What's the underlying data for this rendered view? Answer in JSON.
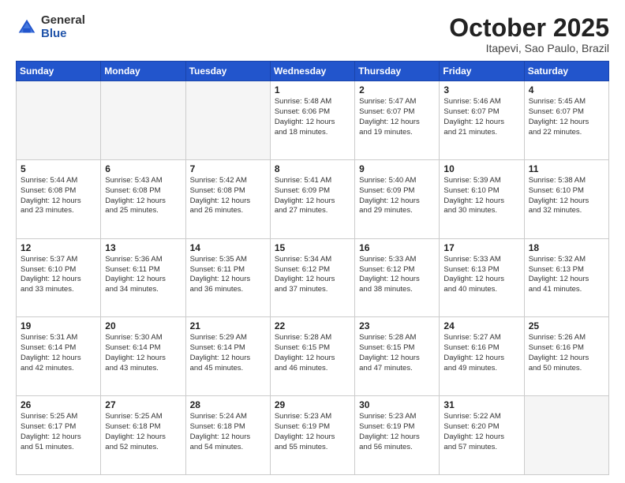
{
  "header": {
    "logo_general": "General",
    "logo_blue": "Blue",
    "month": "October 2025",
    "location": "Itapevi, Sao Paulo, Brazil"
  },
  "days_of_week": [
    "Sunday",
    "Monday",
    "Tuesday",
    "Wednesday",
    "Thursday",
    "Friday",
    "Saturday"
  ],
  "weeks": [
    [
      {
        "day": "",
        "info": ""
      },
      {
        "day": "",
        "info": ""
      },
      {
        "day": "",
        "info": ""
      },
      {
        "day": "1",
        "info": "Sunrise: 5:48 AM\nSunset: 6:06 PM\nDaylight: 12 hours\nand 18 minutes."
      },
      {
        "day": "2",
        "info": "Sunrise: 5:47 AM\nSunset: 6:07 PM\nDaylight: 12 hours\nand 19 minutes."
      },
      {
        "day": "3",
        "info": "Sunrise: 5:46 AM\nSunset: 6:07 PM\nDaylight: 12 hours\nand 21 minutes."
      },
      {
        "day": "4",
        "info": "Sunrise: 5:45 AM\nSunset: 6:07 PM\nDaylight: 12 hours\nand 22 minutes."
      }
    ],
    [
      {
        "day": "5",
        "info": "Sunrise: 5:44 AM\nSunset: 6:08 PM\nDaylight: 12 hours\nand 23 minutes."
      },
      {
        "day": "6",
        "info": "Sunrise: 5:43 AM\nSunset: 6:08 PM\nDaylight: 12 hours\nand 25 minutes."
      },
      {
        "day": "7",
        "info": "Sunrise: 5:42 AM\nSunset: 6:08 PM\nDaylight: 12 hours\nand 26 minutes."
      },
      {
        "day": "8",
        "info": "Sunrise: 5:41 AM\nSunset: 6:09 PM\nDaylight: 12 hours\nand 27 minutes."
      },
      {
        "day": "9",
        "info": "Sunrise: 5:40 AM\nSunset: 6:09 PM\nDaylight: 12 hours\nand 29 minutes."
      },
      {
        "day": "10",
        "info": "Sunrise: 5:39 AM\nSunset: 6:10 PM\nDaylight: 12 hours\nand 30 minutes."
      },
      {
        "day": "11",
        "info": "Sunrise: 5:38 AM\nSunset: 6:10 PM\nDaylight: 12 hours\nand 32 minutes."
      }
    ],
    [
      {
        "day": "12",
        "info": "Sunrise: 5:37 AM\nSunset: 6:10 PM\nDaylight: 12 hours\nand 33 minutes."
      },
      {
        "day": "13",
        "info": "Sunrise: 5:36 AM\nSunset: 6:11 PM\nDaylight: 12 hours\nand 34 minutes."
      },
      {
        "day": "14",
        "info": "Sunrise: 5:35 AM\nSunset: 6:11 PM\nDaylight: 12 hours\nand 36 minutes."
      },
      {
        "day": "15",
        "info": "Sunrise: 5:34 AM\nSunset: 6:12 PM\nDaylight: 12 hours\nand 37 minutes."
      },
      {
        "day": "16",
        "info": "Sunrise: 5:33 AM\nSunset: 6:12 PM\nDaylight: 12 hours\nand 38 minutes."
      },
      {
        "day": "17",
        "info": "Sunrise: 5:33 AM\nSunset: 6:13 PM\nDaylight: 12 hours\nand 40 minutes."
      },
      {
        "day": "18",
        "info": "Sunrise: 5:32 AM\nSunset: 6:13 PM\nDaylight: 12 hours\nand 41 minutes."
      }
    ],
    [
      {
        "day": "19",
        "info": "Sunrise: 5:31 AM\nSunset: 6:14 PM\nDaylight: 12 hours\nand 42 minutes."
      },
      {
        "day": "20",
        "info": "Sunrise: 5:30 AM\nSunset: 6:14 PM\nDaylight: 12 hours\nand 43 minutes."
      },
      {
        "day": "21",
        "info": "Sunrise: 5:29 AM\nSunset: 6:14 PM\nDaylight: 12 hours\nand 45 minutes."
      },
      {
        "day": "22",
        "info": "Sunrise: 5:28 AM\nSunset: 6:15 PM\nDaylight: 12 hours\nand 46 minutes."
      },
      {
        "day": "23",
        "info": "Sunrise: 5:28 AM\nSunset: 6:15 PM\nDaylight: 12 hours\nand 47 minutes."
      },
      {
        "day": "24",
        "info": "Sunrise: 5:27 AM\nSunset: 6:16 PM\nDaylight: 12 hours\nand 49 minutes."
      },
      {
        "day": "25",
        "info": "Sunrise: 5:26 AM\nSunset: 6:16 PM\nDaylight: 12 hours\nand 50 minutes."
      }
    ],
    [
      {
        "day": "26",
        "info": "Sunrise: 5:25 AM\nSunset: 6:17 PM\nDaylight: 12 hours\nand 51 minutes."
      },
      {
        "day": "27",
        "info": "Sunrise: 5:25 AM\nSunset: 6:18 PM\nDaylight: 12 hours\nand 52 minutes."
      },
      {
        "day": "28",
        "info": "Sunrise: 5:24 AM\nSunset: 6:18 PM\nDaylight: 12 hours\nand 54 minutes."
      },
      {
        "day": "29",
        "info": "Sunrise: 5:23 AM\nSunset: 6:19 PM\nDaylight: 12 hours\nand 55 minutes."
      },
      {
        "day": "30",
        "info": "Sunrise: 5:23 AM\nSunset: 6:19 PM\nDaylight: 12 hours\nand 56 minutes."
      },
      {
        "day": "31",
        "info": "Sunrise: 5:22 AM\nSunset: 6:20 PM\nDaylight: 12 hours\nand 57 minutes."
      },
      {
        "day": "",
        "info": ""
      }
    ]
  ]
}
